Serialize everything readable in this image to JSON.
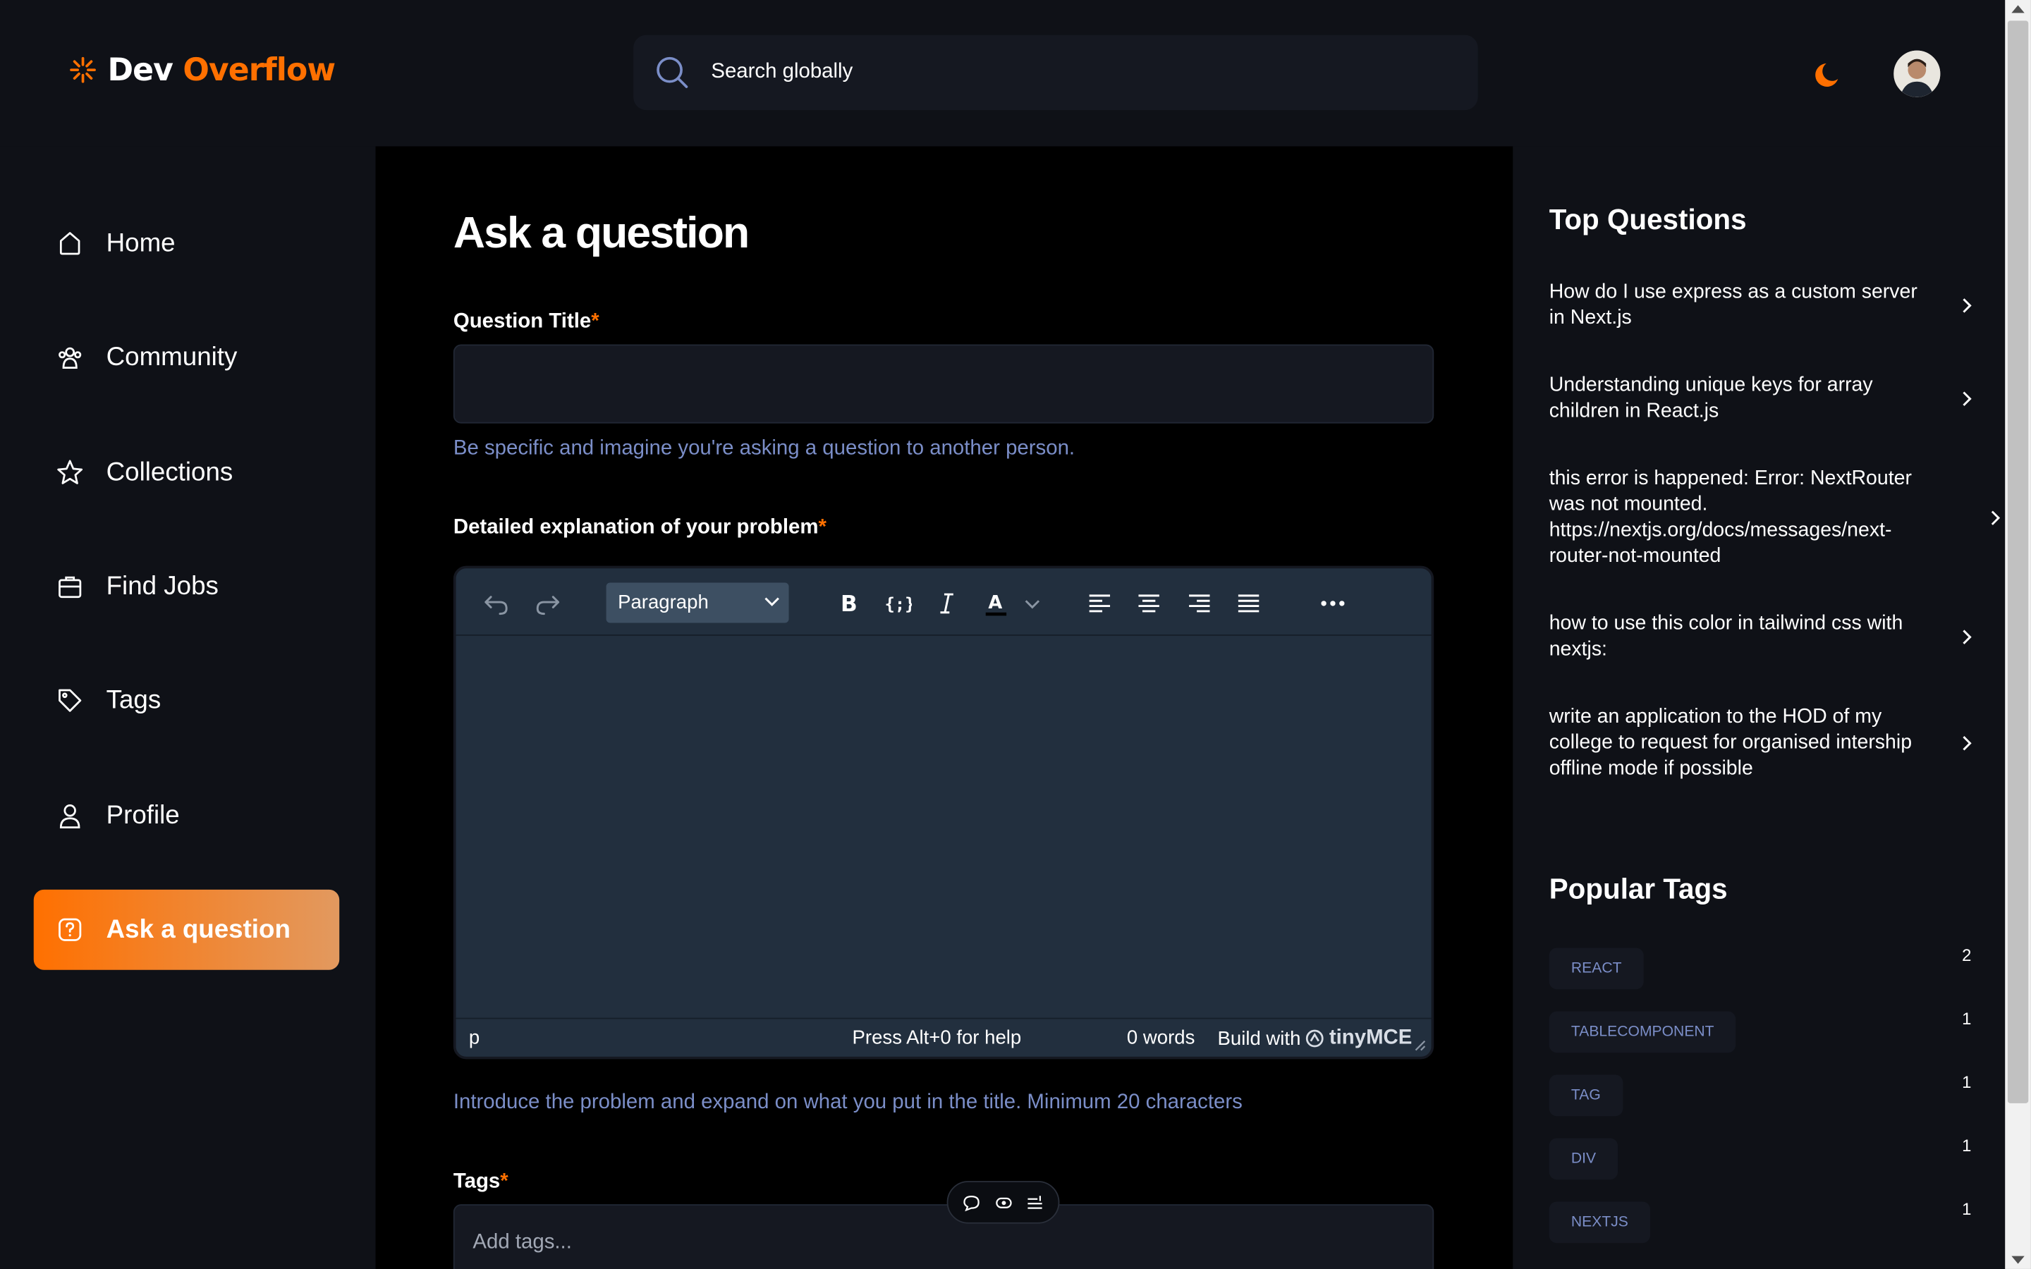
{
  "app": {
    "logo_prefix": "Dev",
    "logo_accent": "Overflow"
  },
  "search": {
    "placeholder": "Search globally"
  },
  "sidebar": {
    "items": [
      {
        "label": "Home",
        "icon": "home-icon"
      },
      {
        "label": "Community",
        "icon": "users-icon"
      },
      {
        "label": "Collections",
        "icon": "star-icon"
      },
      {
        "label": "Find Jobs",
        "icon": "suitcase-icon"
      },
      {
        "label": "Tags",
        "icon": "tag-icon"
      },
      {
        "label": "Profile",
        "icon": "user-icon"
      },
      {
        "label": "Ask a question",
        "icon": "question-icon",
        "active": true
      }
    ]
  },
  "form": {
    "title": "Ask a question",
    "question_title_label": "Question Title",
    "required_mark": "*",
    "question_title_value": "",
    "question_title_hint": "Be specific and imagine you're asking a question to another person.",
    "explanation_label": "Detailed explanation of your problem",
    "explanation_hint": "Introduce the problem and expand on what you put in the title. Minimum 20 characters",
    "tags_label": "Tags",
    "tags_placeholder": "Add tags..."
  },
  "editor": {
    "format": "Paragraph",
    "status_path": "p",
    "status_help": "Press Alt+0 for help",
    "status_words": "0 words",
    "status_build": "Build with",
    "status_brand": "tinyMCE"
  },
  "right": {
    "top_questions_title": "Top Questions",
    "top_questions": [
      "How do I use express as a custom server in Next.js",
      "Understanding unique keys for array children in React.js",
      "this error is happened: Error: NextRouter was not mounted. https://nextjs.org/docs/messages/next-router-not-mounted",
      "how to use this color in tailwind css with nextjs:",
      "write an application to the HOD of my college to request for organised intership offline mode if possible"
    ],
    "popular_tags_title": "Popular Tags",
    "popular_tags": [
      {
        "name": "REACT",
        "count": "2"
      },
      {
        "name": "TABLECOMPONENT",
        "count": "1"
      },
      {
        "name": "TAG",
        "count": "1"
      },
      {
        "name": "DIV",
        "count": "1"
      },
      {
        "name": "NEXTJS",
        "count": "1"
      }
    ]
  },
  "colors": {
    "accent": "#ff7000",
    "hint": "#7b8ec8",
    "panel": "#0f1117",
    "editor": "#222f3e"
  }
}
